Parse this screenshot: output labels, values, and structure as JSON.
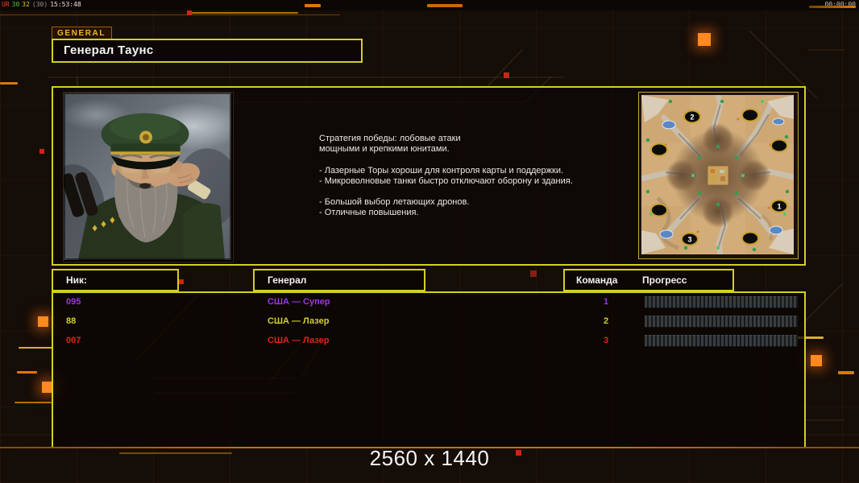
{
  "hud": {
    "debug_segments": [
      {
        "text": "UR",
        "color": "#e04a30"
      },
      {
        "text": "30",
        "color": "#55c23c"
      },
      {
        "text": "32",
        "color": "#d8c52e"
      },
      {
        "text": "(30)",
        "color": "#9a948c"
      },
      {
        "text": "15:53:48",
        "color": "#e6e2da"
      }
    ],
    "timer": "00:00:00",
    "resolution_label": "2560 x 1440"
  },
  "header": {
    "tab_label": "GENERAL",
    "title": "Генерал Таунс"
  },
  "briefing": {
    "lines": [
      "Стратегия победы: лобовые атаки",
      "мощными и крепкими юнитами.",
      "",
      "- Лазерные Торы хороши для контроля карты и поддержки.",
      "- Микроволновые танки быстро отключают оборону и здания.",
      "",
      "- Большой выбор летающих дронов.",
      "- Отличные повышения."
    ]
  },
  "map": {
    "markers": [
      {
        "label": "2"
      },
      {
        "label": "1"
      },
      {
        "label": "3"
      }
    ]
  },
  "players": {
    "columns": {
      "nick": "Ник:",
      "general": "Генерал",
      "team": "Команда",
      "progress": "Прогресс"
    },
    "rows": [
      {
        "nick": "095",
        "general": "США — Супер",
        "team": "1",
        "color": "#9a36e8",
        "progress_percent": 0
      },
      {
        "nick": "88",
        "general": "США — Лазер",
        "team": "2",
        "color": "#d2d02a",
        "progress_percent": 0
      },
      {
        "nick": "007",
        "general": "США — Лазер",
        "team": "3",
        "color": "#e0241a",
        "progress_percent": 0
      }
    ]
  },
  "colors": {
    "panel_border": "#d3d11f",
    "accent_orange": "#e07800",
    "line_orange": "#c96a00",
    "background": "#150d08"
  }
}
